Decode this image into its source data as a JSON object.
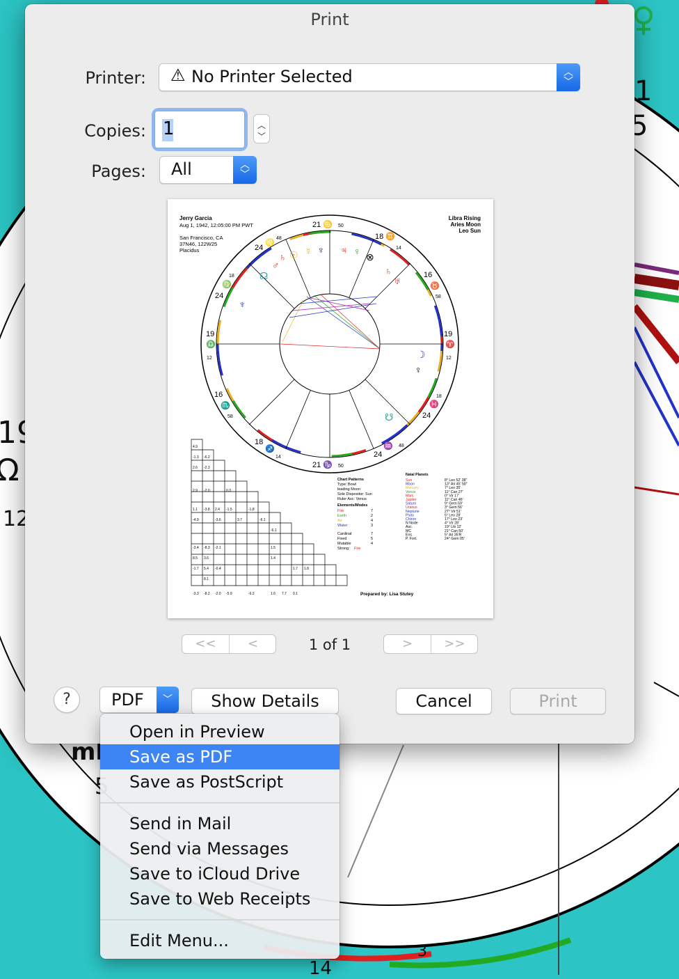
{
  "background": {
    "texts": [
      "19",
      "Ω",
      "12",
      "1",
      "5",
      "3",
      "14",
      "ml",
      "5"
    ],
    "colors": {
      "desktop": "#2cc4c4"
    }
  },
  "dialog": {
    "title": "Print",
    "printer_label": "Printer:",
    "printer_value": "No Printer Selected",
    "warning_icon": "warning-triangle-icon",
    "copies_label": "Copies:",
    "copies_value": "1",
    "pages_label": "Pages:",
    "pages_value": "All",
    "page_indicator": "1 of 1",
    "nav": {
      "first": "<<",
      "prev": "<",
      "next": ">",
      "last": ">>"
    },
    "help_label": "?",
    "pdf_label": "PDF",
    "show_details_label": "Show Details",
    "cancel_label": "Cancel",
    "print_label": "Print"
  },
  "preview": {
    "name": "Jerry Garcia",
    "datetime": "Aug 1, 1942, 12:05:00 PM PWT",
    "location": "San Francisco, CA",
    "coords": "37N46, 122W25",
    "house_system": "Placidus",
    "rising": "Libra Rising",
    "moon": "Aries Moon",
    "sun": "Leo Sun",
    "prepared_by": "Prepared by: Lisa Stutey",
    "wheel_labels": [
      "21 ♋ 50",
      "18 ♊ 14",
      "16 ♉ 58",
      "19 ♈ 12",
      "18 ♓ 24",
      "24 ♒ 48",
      "21 ♑ 50",
      "18 ♐ 14",
      "16 ♏ 58",
      "19 ♎ 12",
      "18 ♍ 24",
      "24 ♌ 48"
    ],
    "patterns": [
      "Chart Patterns",
      "Type: Bowl",
      "  leading Moon",
      "Sole Dispositor: Sun",
      "Ruler Asc: Venus"
    ],
    "elements_title": "Elements/Modes",
    "elements": [
      {
        "name": "Fire",
        "value": "7"
      },
      {
        "name": "Earth",
        "value": "2"
      },
      {
        "name": "Air",
        "value": "4"
      },
      {
        "name": "Water",
        "value": "3"
      }
    ],
    "modes": [
      {
        "name": "Cardinal",
        "value": "7"
      },
      {
        "name": "Fixed",
        "value": "5"
      },
      {
        "name": "Mutable",
        "value": "4"
      },
      {
        "name": "Strong:",
        "value": "Fire"
      }
    ],
    "natal_title": "Natal Planets",
    "natal": [
      {
        "name": "Sun",
        "pos": "8° Leo 52' 38\""
      },
      {
        "name": "Moon",
        "pos": "13° Ari 45' 58\""
      },
      {
        "name": "Mercury",
        "pos": "7° Leo 35'"
      },
      {
        "name": "Venus",
        "pos": "11° Can 27'"
      },
      {
        "name": "Mars",
        "pos": "0° Vir 17'"
      },
      {
        "name": "Jupiter",
        "pos": "11° Can 46'"
      },
      {
        "name": "Saturn",
        "pos": "9° Gem 59'"
      },
      {
        "name": "Uranus",
        "pos": "3° Gem 56'"
      },
      {
        "name": "Neptune",
        "pos": "27° Vir 51'"
      },
      {
        "name": "Pluto",
        "pos": "5° Leo 28'"
      },
      {
        "name": "Chiron",
        "pos": "17° Leo 23'"
      },
      {
        "name": "N Node",
        "pos": "4° Vir 28'"
      },
      {
        "name": "Asc.",
        "pos": "19° Lib 12'"
      },
      {
        "name": "MC",
        "pos": "21° Can 50'"
      },
      {
        "name": "Eris",
        "pos": "5° Ari 35'R"
      },
      {
        "name": "P. Fort.",
        "pos": "24° Gem 05'"
      }
    ]
  },
  "menu": {
    "items": [
      {
        "label": "Open in Preview",
        "highlighted": false
      },
      {
        "label": "Save as PDF",
        "highlighted": true
      },
      {
        "label": "Save as PostScript",
        "highlighted": false
      },
      {
        "label": "Send in Mail",
        "highlighted": false
      },
      {
        "label": "Send via Messages",
        "highlighted": false
      },
      {
        "label": "Save to iCloud Drive",
        "highlighted": false
      },
      {
        "label": "Save to Web Receipts",
        "highlighted": false
      },
      {
        "label": "Edit Menu...",
        "highlighted": false
      }
    ]
  },
  "colors": {
    "accent": "#3d85f4",
    "fire": "#e02020",
    "earth": "#22aa22",
    "air": "#e8b020",
    "water": "#2233cc"
  }
}
